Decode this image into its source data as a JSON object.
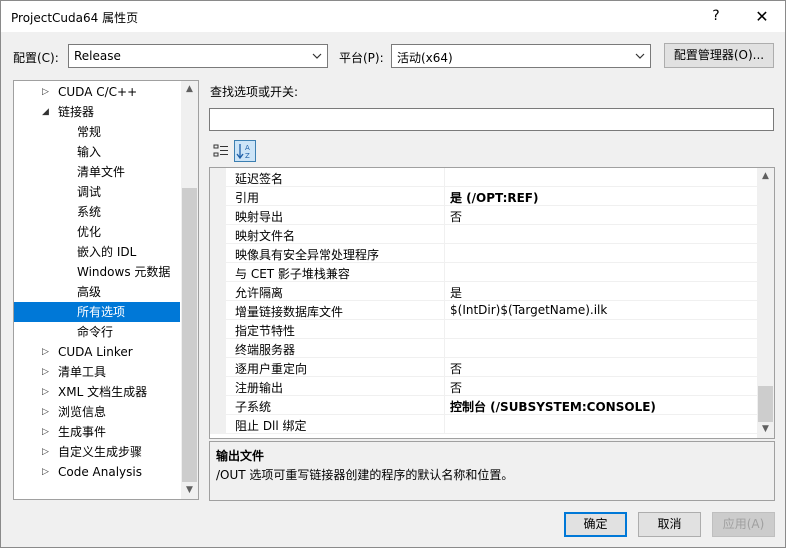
{
  "window": {
    "title": "ProjectCuda64 属性页",
    "help_glyph": "?",
    "close_glyph": "✕"
  },
  "config": {
    "label": "配置(C):",
    "value": "Release"
  },
  "platform": {
    "label": "平台(P):",
    "value": "活动(x64)"
  },
  "config_manager_label": "配置管理器(O)...",
  "search_label": "查找选项或开关:",
  "search_value": "",
  "tree": [
    {
      "label": "CUDA C/C++",
      "twisty": "▷"
    },
    {
      "label": "链接器",
      "twisty": "◢"
    },
    {
      "label": "常规"
    },
    {
      "label": "输入"
    },
    {
      "label": "清单文件"
    },
    {
      "label": "调试"
    },
    {
      "label": "系统"
    },
    {
      "label": "优化"
    },
    {
      "label": "嵌入的 IDL"
    },
    {
      "label": "Windows 元数据"
    },
    {
      "label": "高级"
    },
    {
      "label": "所有选项"
    },
    {
      "label": "命令行"
    },
    {
      "label": "CUDA Linker",
      "twisty": "▷"
    },
    {
      "label": "清单工具",
      "twisty": "▷"
    },
    {
      "label": "XML 文档生成器",
      "twisty": "▷"
    },
    {
      "label": "浏览信息",
      "twisty": "▷"
    },
    {
      "label": "生成事件",
      "twisty": "▷"
    },
    {
      "label": "自定义生成步骤",
      "twisty": "▷"
    },
    {
      "label": "Code Analysis",
      "twisty": "▷"
    }
  ],
  "properties": [
    {
      "key": "延迟签名",
      "value": ""
    },
    {
      "key": "引用",
      "value": "是 (/OPT:REF)"
    },
    {
      "key": "映射导出",
      "value": "否"
    },
    {
      "key": "映射文件名",
      "value": ""
    },
    {
      "key": "映像具有安全异常处理程序",
      "value": ""
    },
    {
      "key": "与 CET 影子堆栈兼容",
      "value": ""
    },
    {
      "key": "允许隔离",
      "value": "是"
    },
    {
      "key": "增量链接数据库文件",
      "value": "$(IntDir)$(TargetName).ilk"
    },
    {
      "key": "指定节特性",
      "value": ""
    },
    {
      "key": "终端服务器",
      "value": ""
    },
    {
      "key": "逐用户重定向",
      "value": "否"
    },
    {
      "key": "注册输出",
      "value": "否"
    },
    {
      "key": "子系统",
      "value": "控制台 (/SUBSYSTEM:CONSOLE)"
    },
    {
      "key": "阻止 Dll 绑定",
      "value": ""
    }
  ],
  "description": {
    "title": "输出文件",
    "text": "/OUT 选项可重写链接器创建的程序的默认名称和位置。"
  },
  "buttons": {
    "ok": "确定",
    "cancel": "取消",
    "apply": "应用(A)"
  },
  "colors": {
    "accent": "#0078d7",
    "dialog_bg": "#f0f0f0"
  }
}
